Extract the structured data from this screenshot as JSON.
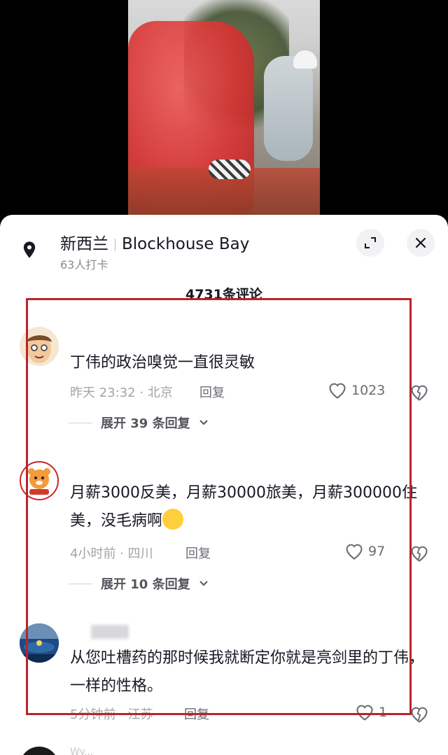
{
  "location": {
    "country": "新西兰",
    "place": "Blockhouse Bay",
    "checkins": "63人打卡"
  },
  "comment_count": "4731条评论",
  "comments": [
    {
      "username": "",
      "text": "丁伟的政治嗅觉一直很灵敏",
      "time_loc": "昨天 23:32 · 北京",
      "reply_label": "回复",
      "likes": "1023",
      "expand": "展开 39 条回复"
    },
    {
      "username": "",
      "text": "月薪3000反美，月薪30000旅美，月薪300000住美，没毛病啊",
      "time_loc": "4小时前 · 四川",
      "reply_label": "回复",
      "likes": "97",
      "expand": "展开 10 条回复"
    },
    {
      "username": "",
      "text": "从您吐槽药的那时候我就断定你就是亮剑里的丁伟，一样的性格。",
      "time_loc": "5分钟前 · 江苏",
      "reply_label": "回复",
      "likes": "1"
    },
    {
      "username": "Wy..."
    }
  ],
  "icons": {
    "location": "location-pin-icon",
    "expand": "expand-icon",
    "close": "close-icon",
    "like": "heart-icon",
    "dislike": "broken-heart-icon",
    "chevron": "chevron-down-icon"
  },
  "colors": {
    "highlight_border": "#b8242a",
    "text_primary": "#161823",
    "text_secondary": "#a3a4a9"
  }
}
